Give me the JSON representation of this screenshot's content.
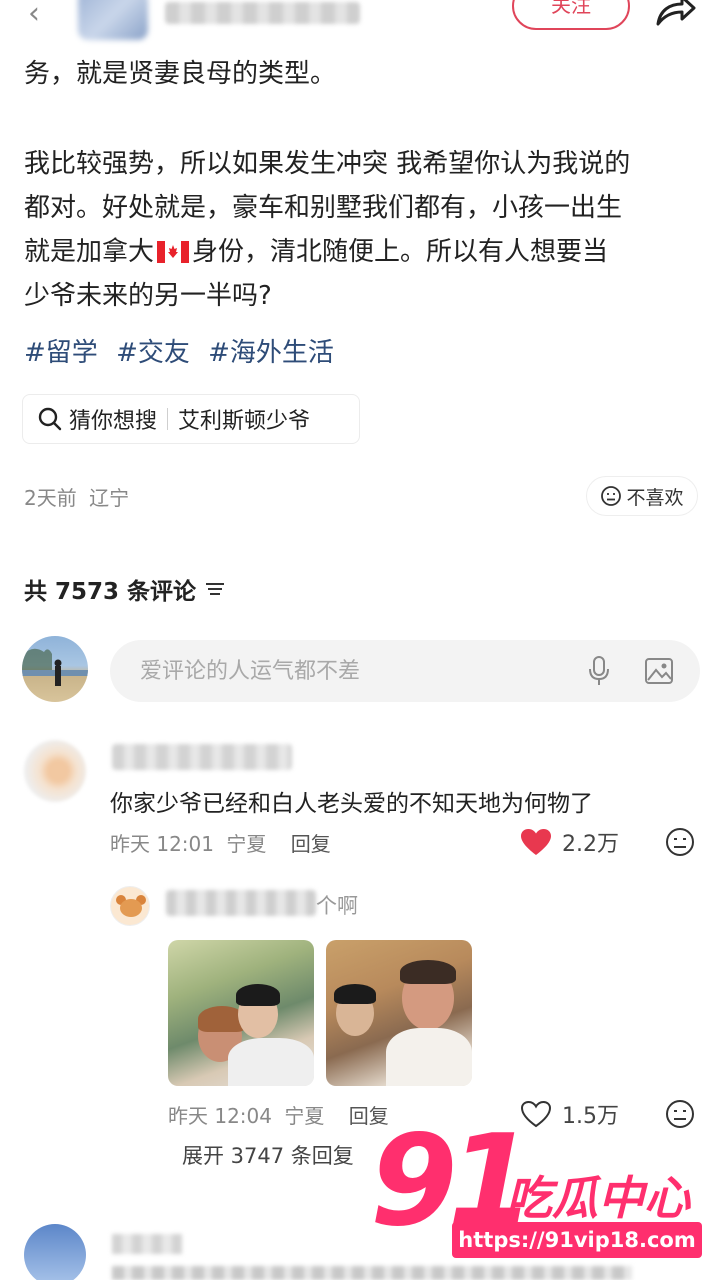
{
  "header": {
    "follow_label": "关注"
  },
  "post": {
    "line1": "务，就是贤妻良母的类型。",
    "para2_a": "我比较强势，所以如果发生冲突 我希望你认为我说的",
    "para2_b": "都对。好处就是，豪车和别墅我们都有，小孩一出生",
    "para2_c1": "就是加拿大",
    "para2_c2": "身份，清北随便上。所以有人想要当",
    "para2_d": "少爷未来的另一半吗?",
    "tags": [
      "#留学",
      "#交友",
      "#海外生活"
    ],
    "guess_label": "猜你想搜",
    "guess_term": "艾利斯顿少爷",
    "time": "2天前",
    "location": "辽宁",
    "dislike_label": "不喜欢"
  },
  "comments_header": {
    "count_text": "共 7573 条评论"
  },
  "comment_input": {
    "placeholder": "爱评论的人运气都不差"
  },
  "comment1": {
    "text": "你家少爷已经和白人老头爱的不知天地为何物了",
    "time": "昨天 12:01",
    "location": "宁夏",
    "reply_label": "回复",
    "likes": "2.2万"
  },
  "reply1": {
    "text_visible": "个啊",
    "time": "昨天 12:04",
    "location": "宁夏",
    "reply_label": "回复",
    "likes": "1.5万",
    "expand_label": "展开 3747 条回复"
  },
  "watermark": {
    "number": "91",
    "name": "吃瓜中心",
    "url": "https://91vip18.com"
  },
  "colors": {
    "accent": "#e0455a",
    "tag": "#2e4c78",
    "heart": "#e8384f",
    "watermark": "#ff2f6e"
  }
}
